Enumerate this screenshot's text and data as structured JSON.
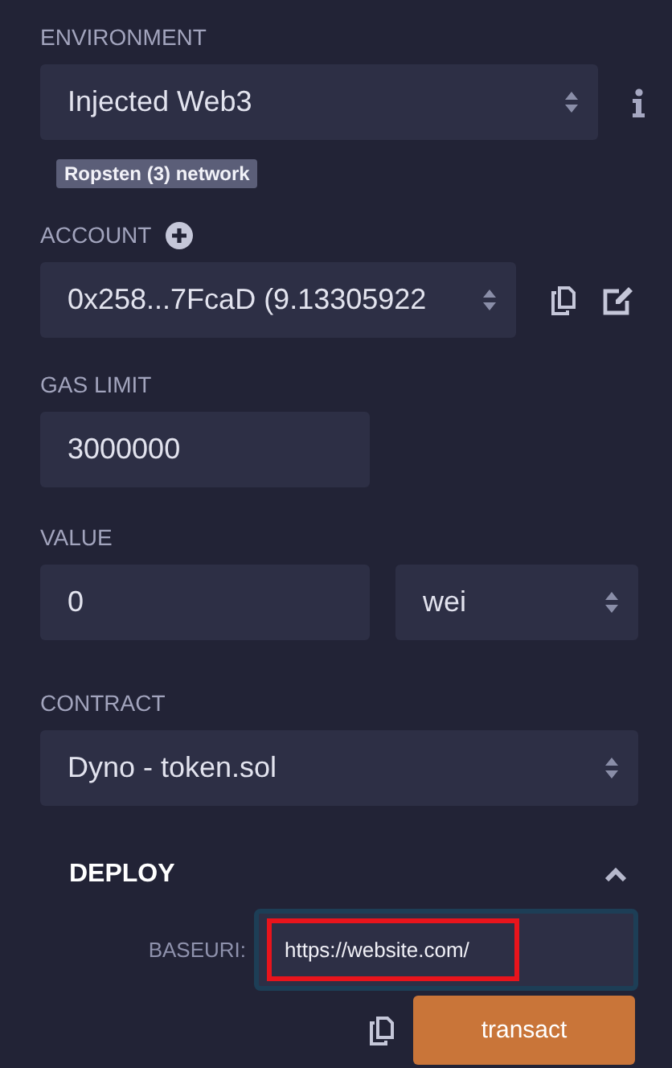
{
  "environment": {
    "label": "ENVIRONMENT",
    "value": "Injected Web3",
    "network_badge": "Ropsten (3) network"
  },
  "account": {
    "label": "ACCOUNT",
    "value": "0x258...7FcaD (9.13305922"
  },
  "gas_limit": {
    "label": "GAS LIMIT",
    "value": "3000000"
  },
  "value": {
    "label": "VALUE",
    "amount": "0",
    "unit": "wei"
  },
  "contract": {
    "label": "CONTRACT",
    "value": "Dyno - token.sol"
  },
  "deploy": {
    "title": "DEPLOY",
    "expanded": true,
    "params": [
      {
        "label": "BASEURI:",
        "value": "https://website.com/",
        "highlighted": true
      }
    ],
    "button": "transact"
  }
}
